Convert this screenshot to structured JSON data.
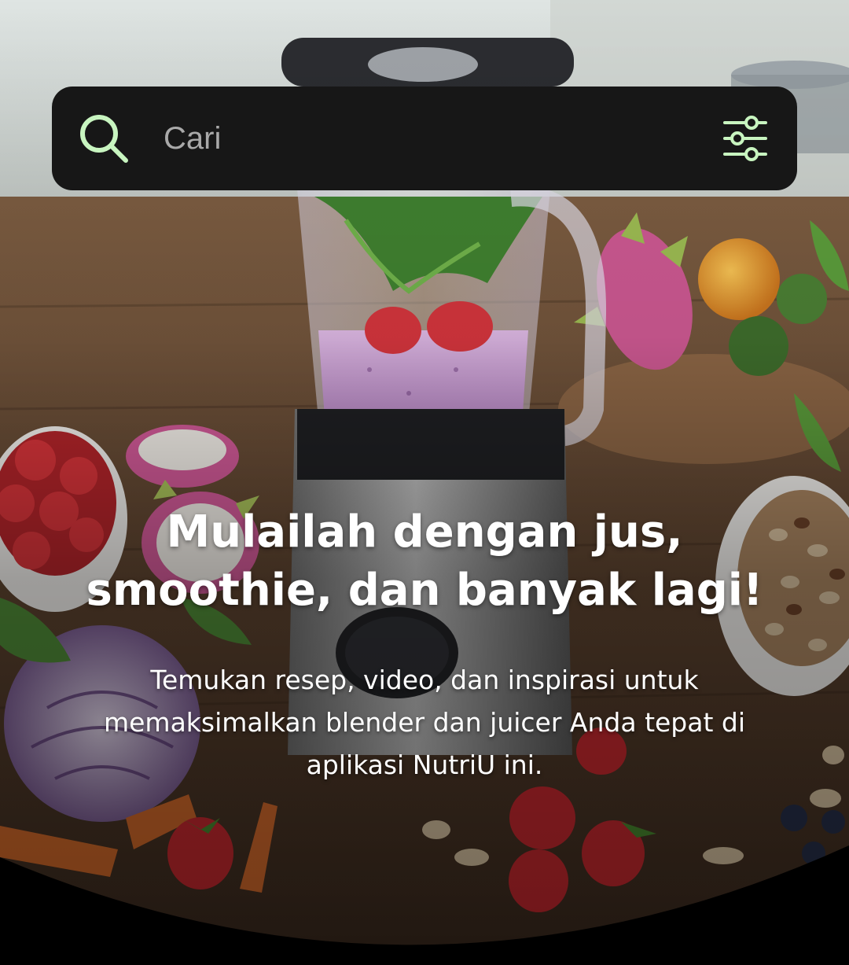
{
  "search": {
    "placeholder": "Cari"
  },
  "hero": {
    "headline_lines": [
      "Mulailah dengan jus,",
      "smoothie, dan banyak lagi!"
    ],
    "subtext_lines": [
      "Temukan resep, video, dan inspirasi untuk",
      "memaksimalkan blender dan juicer Anda tepat di",
      "aplikasi NutriU ini."
    ]
  },
  "colors": {
    "search_bar_bg": "#171717",
    "icon_accent": "#c8f5c0",
    "placeholder_text": "#a9a9a9",
    "headline_text": "#ffffff"
  },
  "icons": {
    "search": "search-icon",
    "filter": "filter-sliders-icon"
  }
}
